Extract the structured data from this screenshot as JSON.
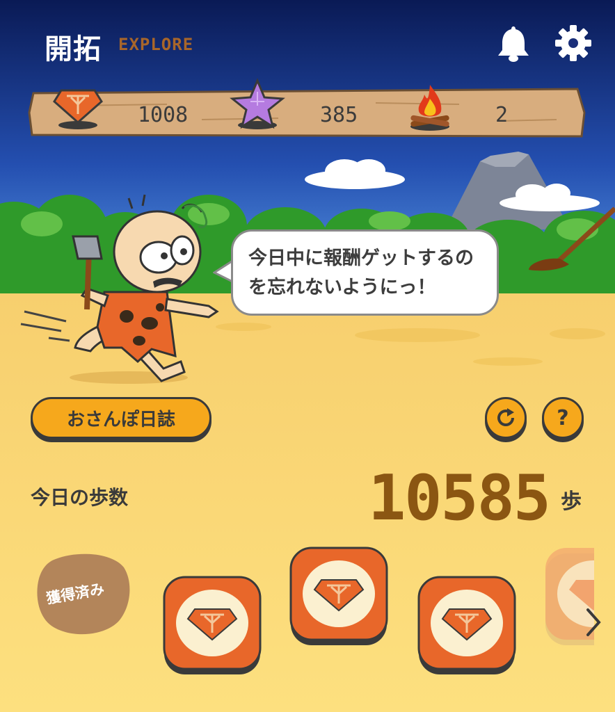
{
  "header": {
    "title": "開拓",
    "subtitle": "EXPLORE",
    "bell_icon": "bell-icon",
    "settings_icon": "gear-icon"
  },
  "stats": [
    {
      "icon": "orange-gem-icon",
      "value": "1008"
    },
    {
      "icon": "purple-star-icon",
      "value": "385"
    },
    {
      "icon": "campfire-icon",
      "value": "2"
    }
  ],
  "speech_bubble": "今日中に報酬ゲットするのを忘れないようにっ！",
  "buttons": {
    "diary": "おさんぽ日誌",
    "refresh_icon": "refresh-icon",
    "help": "?"
  },
  "steps": {
    "label": "今日の歩数",
    "value": "10585",
    "unit": "歩"
  },
  "rewards": {
    "claimed_label": "獲得済み",
    "card_icon": "orange-gem-icon",
    "next_icon": "chevron-right-icon"
  },
  "colors": {
    "sky_top": "#0a1a55",
    "sky_bottom": "#4d8fe0",
    "sand": "#fde07f",
    "accent": "#f6a81c",
    "card_orange": "#e8672a",
    "steps_brown": "#8b5612"
  }
}
